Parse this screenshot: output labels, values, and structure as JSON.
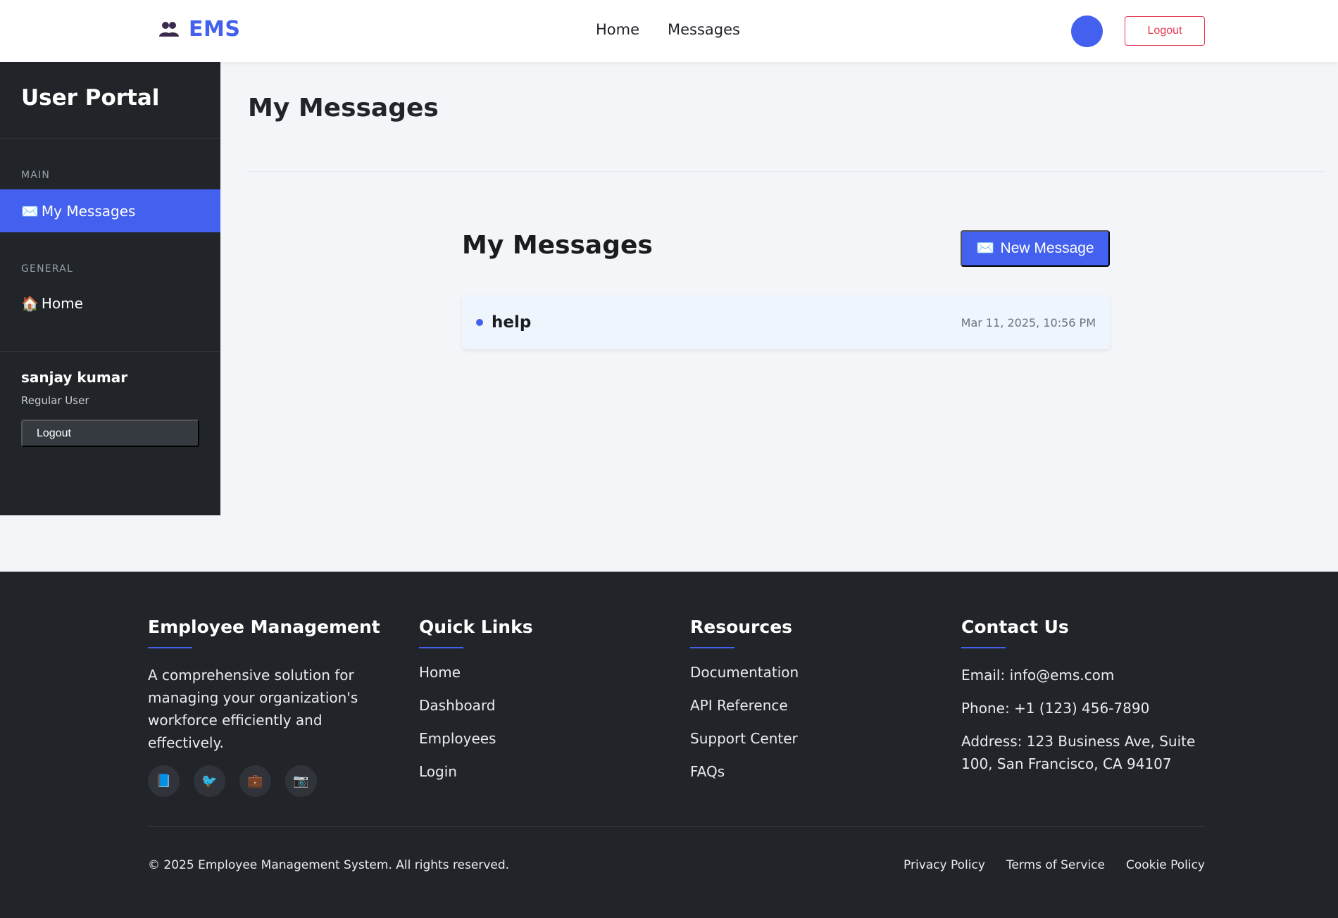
{
  "topnav": {
    "brand": "EMS",
    "links": [
      "Home",
      "Messages"
    ],
    "logout": "Logout"
  },
  "sidebar": {
    "title": "User Portal",
    "sections": [
      {
        "label": "MAIN",
        "items": [
          {
            "icon": "✉️",
            "label": "My Messages",
            "active": true
          }
        ]
      },
      {
        "label": "GENERAL",
        "items": [
          {
            "icon": "🏠",
            "label": "Home",
            "active": false
          }
        ]
      }
    ],
    "user": {
      "name": "sanjay kumar",
      "role": "Regular User",
      "logout": "Logout"
    }
  },
  "main": {
    "page_title": "My Messages",
    "card_heading": "My Messages",
    "new_message": {
      "icon": "✉️",
      "label": "New Message"
    },
    "messages": [
      {
        "subject": "help",
        "date": "Mar 11, 2025, 10:56 PM",
        "unread": true
      }
    ]
  },
  "footer": {
    "about": {
      "title": "Employee Management",
      "description": "A comprehensive solution for managing your organization's workforce efficiently and effectively.",
      "socials": [
        "📘",
        "🐦",
        "💼",
        "📷"
      ]
    },
    "quick_links": {
      "title": "Quick Links",
      "items": [
        "Home",
        "Dashboard",
        "Employees",
        "Login"
      ]
    },
    "resources": {
      "title": "Resources",
      "items": [
        "Documentation",
        "API Reference",
        "Support Center",
        "FAQs"
      ]
    },
    "contact": {
      "title": "Contact Us",
      "email": "Email: info@ems.com",
      "phone": "Phone: +1 (123) 456-7890",
      "address": "Address: 123 Business Ave, Suite 100, San Francisco, CA 94107"
    },
    "copyright": "© 2025 Employee Management System. All rights reserved.",
    "bottom_links": [
      "Privacy Policy",
      "Terms of Service",
      "Cookie Policy"
    ]
  },
  "colors": {
    "accent": "#4361ee",
    "sidebar_bg": "#212429",
    "danger": "#e53950"
  }
}
